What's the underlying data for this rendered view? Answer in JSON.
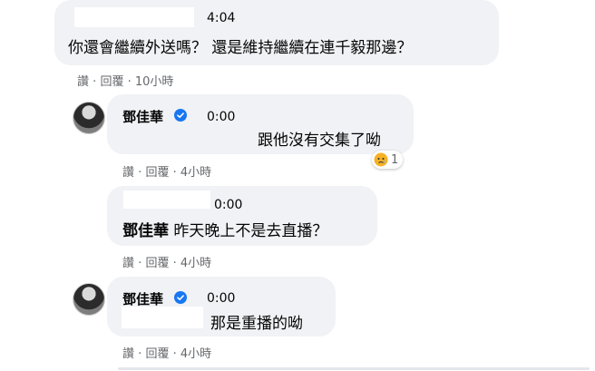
{
  "comments": [
    {
      "time": "4:04",
      "text": "你還會繼續外送嗎？ 還是維持繼續在連千毅那邊？",
      "actions": {
        "like": "讚",
        "reply": "回覆",
        "age": "10小時"
      }
    },
    {
      "name": "鄧佳華",
      "time": "0:00",
      "text": "跟他沒有交集了呦",
      "reaction_count": "1",
      "actions": {
        "like": "讚",
        "reply": "回覆",
        "age": "4小時"
      }
    },
    {
      "time": "0:00",
      "mention": "鄧佳華",
      "text": " 昨天晚上不是去直播？",
      "actions": {
        "like": "讚",
        "reply": "回覆",
        "age": "4小時"
      }
    },
    {
      "name": "鄧佳華",
      "time": "0:00",
      "text": "那是重播的呦",
      "actions": {
        "like": "讚",
        "reply": "回覆",
        "age": "4小時"
      }
    }
  ],
  "separator": "·",
  "icons": {
    "verified": "verified-badge-icon",
    "reaction": "sad-reaction-icon"
  },
  "colors": {
    "bubble": "#f0f2f5",
    "meta": "#65676b",
    "verified": "#1877f2"
  }
}
